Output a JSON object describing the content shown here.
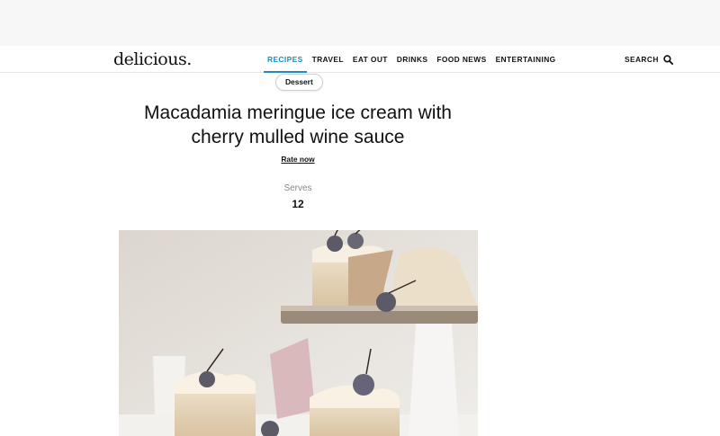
{
  "header": {
    "logo": "delicious.",
    "nav": [
      {
        "label": "RECIPES",
        "active": true
      },
      {
        "label": "TRAVEL",
        "active": false
      },
      {
        "label": "EAT OUT",
        "active": false
      },
      {
        "label": "DRINKS",
        "active": false
      },
      {
        "label": "FOOD NEWS",
        "active": false
      },
      {
        "label": "ENTERTAINING",
        "active": false
      }
    ],
    "search_label": "SEARCH",
    "search_icon": "search-icon",
    "accent_color": "#1e8ec0"
  },
  "recipe": {
    "category": "Dessert",
    "title": "Macadamia meringue ice cream with cherry mulled wine sauce",
    "rate_label": "Rate now",
    "serves_label": "Serves",
    "serves_value": "12"
  }
}
